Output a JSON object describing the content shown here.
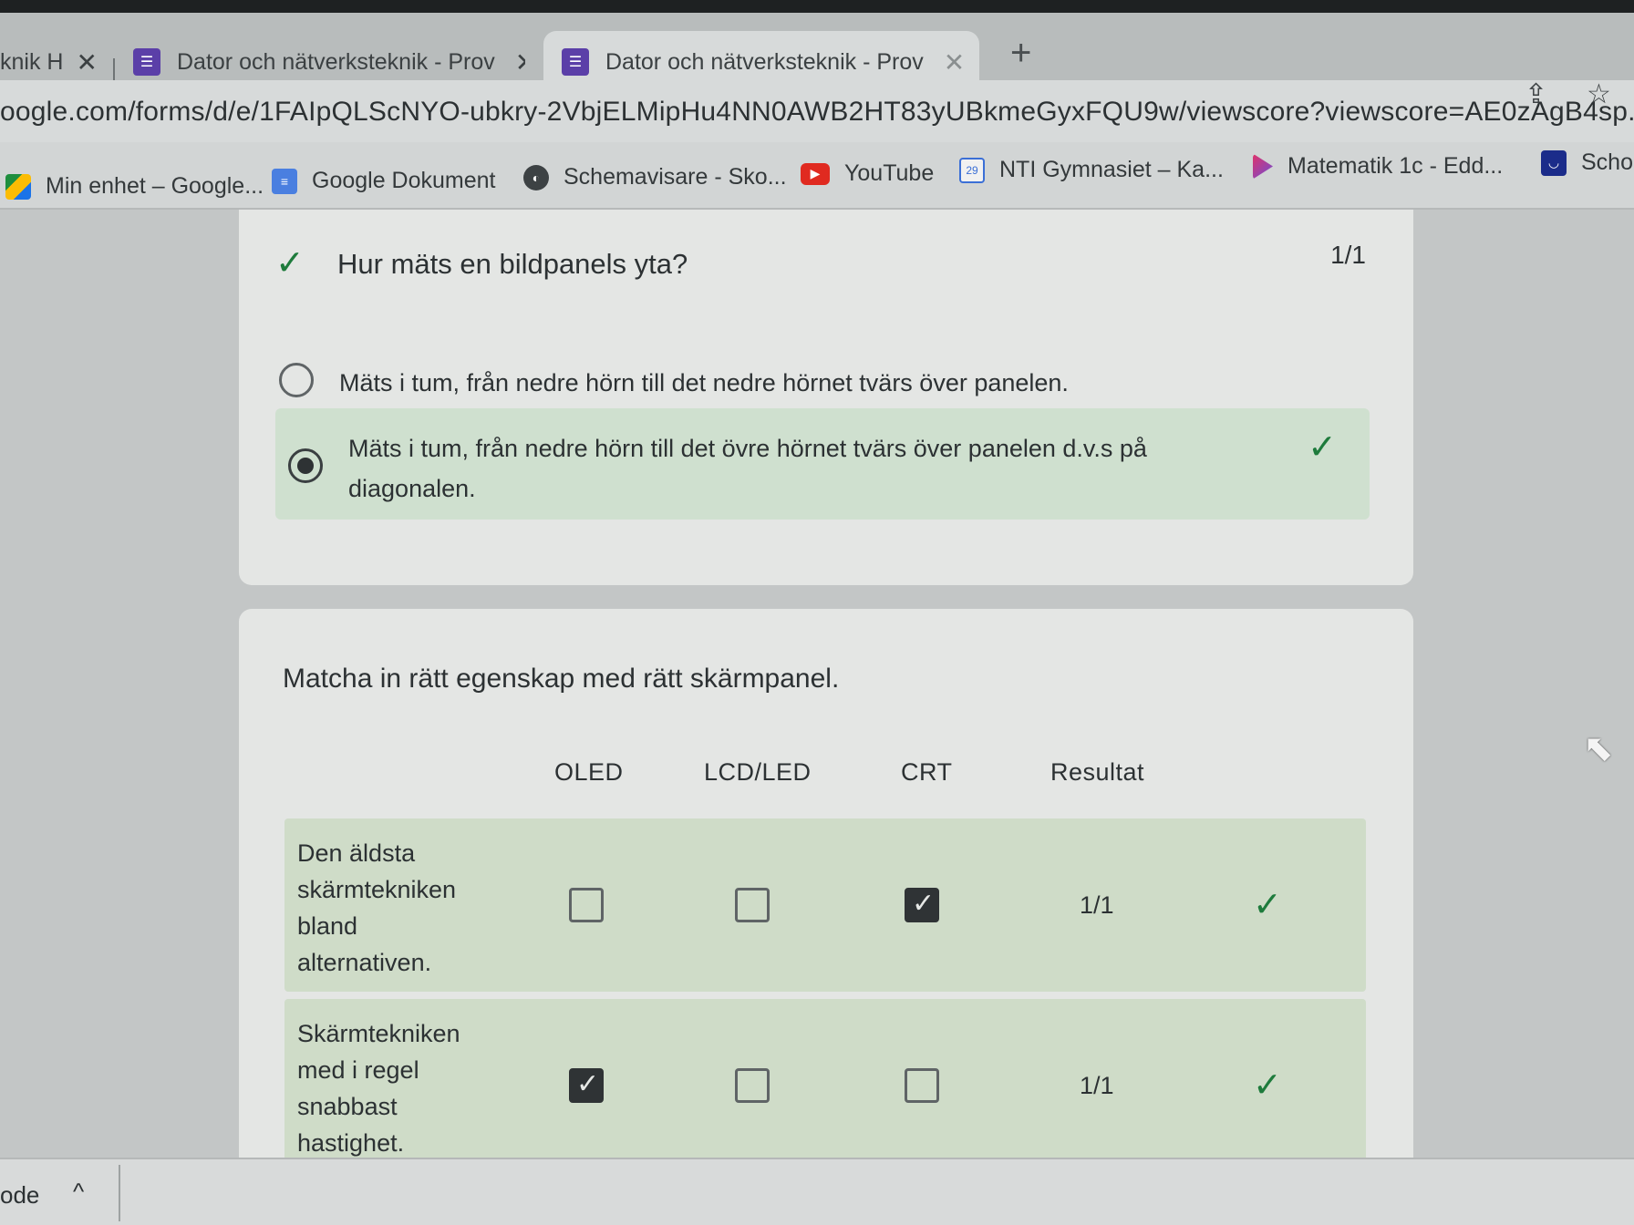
{
  "browser": {
    "tabs": [
      {
        "label": "knik H",
        "close": "✕"
      },
      {
        "label": "Dator och nätverksteknik - Prov",
        "close": "✕"
      },
      {
        "label": "Dator och nätverksteknik - Prov",
        "close": "✕"
      }
    ],
    "new_tab": "+",
    "url": "oogle.com/forms/d/e/1FAIpQLScNYO-ubkry-2VbjELMipHu4NN0AWB2HT83yUBkmeGyxFQU9w/viewscore?viewscore=AE0zAgB4sp...",
    "bookmarks": [
      {
        "label": "Min enhet – Google...",
        "icon": "drive-icon"
      },
      {
        "label": "Google Dokument",
        "icon": "docs-icon"
      },
      {
        "label": "Schemavisare - Sko...",
        "icon": "globe-icon"
      },
      {
        "label": "YouTube",
        "icon": "youtube-icon"
      },
      {
        "label": "NTI Gymnasiet – Ka...",
        "icon": "calendar-icon",
        "badge": "29"
      },
      {
        "label": "Matematik 1c - Edd...",
        "icon": "flag-icon"
      },
      {
        "label": "Scho",
        "icon": "school-icon"
      }
    ]
  },
  "question1": {
    "title": "Hur mäts en bildpanels yta?",
    "score": "1/1",
    "options": [
      {
        "text": "Mäts i tum, från nedre hörn till det nedre hörnet tvärs över panelen.",
        "selected": false
      },
      {
        "text": "Mäts i tum, från nedre hörn till det övre hörnet tvärs över panelen d.v.s på diagonalen.",
        "selected": true,
        "correct": true
      }
    ]
  },
  "question2": {
    "title": "Matcha in rätt egenskap med rätt skärmpanel.",
    "columns": [
      "OLED",
      "LCD/LED",
      "CRT",
      "Resultat"
    ],
    "rows": [
      {
        "label": "Den äldsta skärmtekniken bland alternativen.",
        "checked": [
          false,
          false,
          true
        ],
        "score": "1/1"
      },
      {
        "label": "Skärmtekniken med i regel snabbast hastighet.",
        "checked": [
          true,
          false,
          false
        ],
        "score": "1/1"
      }
    ]
  },
  "download_bar": {
    "text": "ode",
    "chevron": "^"
  }
}
